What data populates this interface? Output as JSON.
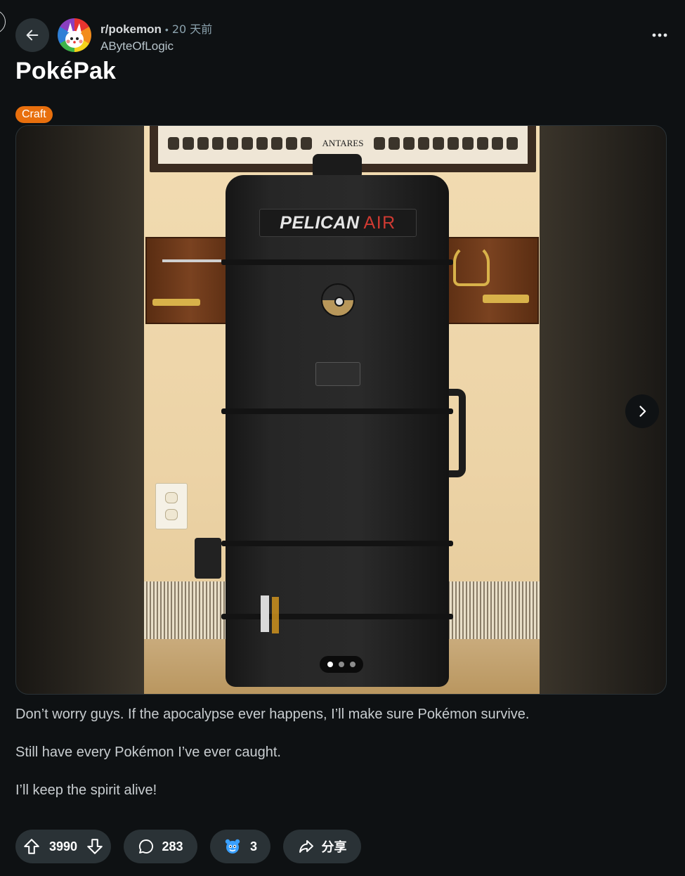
{
  "post": {
    "subreddit": "r/pokemon",
    "separator": "•",
    "time": "20 天前",
    "author": "AByteOfLogic",
    "title": "PokéPak",
    "flair": "Craft"
  },
  "media": {
    "frame_text": "ANTARES",
    "case_brand": "PELICAN",
    "case_brand_accent": "AIR",
    "pager_total": 3,
    "pager_active": 1
  },
  "body": {
    "paragraphs": [
      "Don’t worry guys. If the apocalypse ever happens, I’ll make sure Pokémon survive.",
      "Still have every Pokémon I’ve ever caught.",
      "I’ll keep the spirit alive!"
    ]
  },
  "actions": {
    "votes": "3990",
    "comments": "283",
    "awards": "3",
    "share_label": "分享"
  },
  "colors": {
    "background": "#0e1113",
    "button_bg": "#2a3236",
    "flair_bg": "#e86f0d",
    "award_blue": "#3aa0ff"
  },
  "icons": [
    "back-arrow-icon",
    "more-options-icon",
    "chevron-right-icon",
    "upvote-icon",
    "downvote-icon",
    "comment-icon",
    "award-icon",
    "share-icon"
  ]
}
